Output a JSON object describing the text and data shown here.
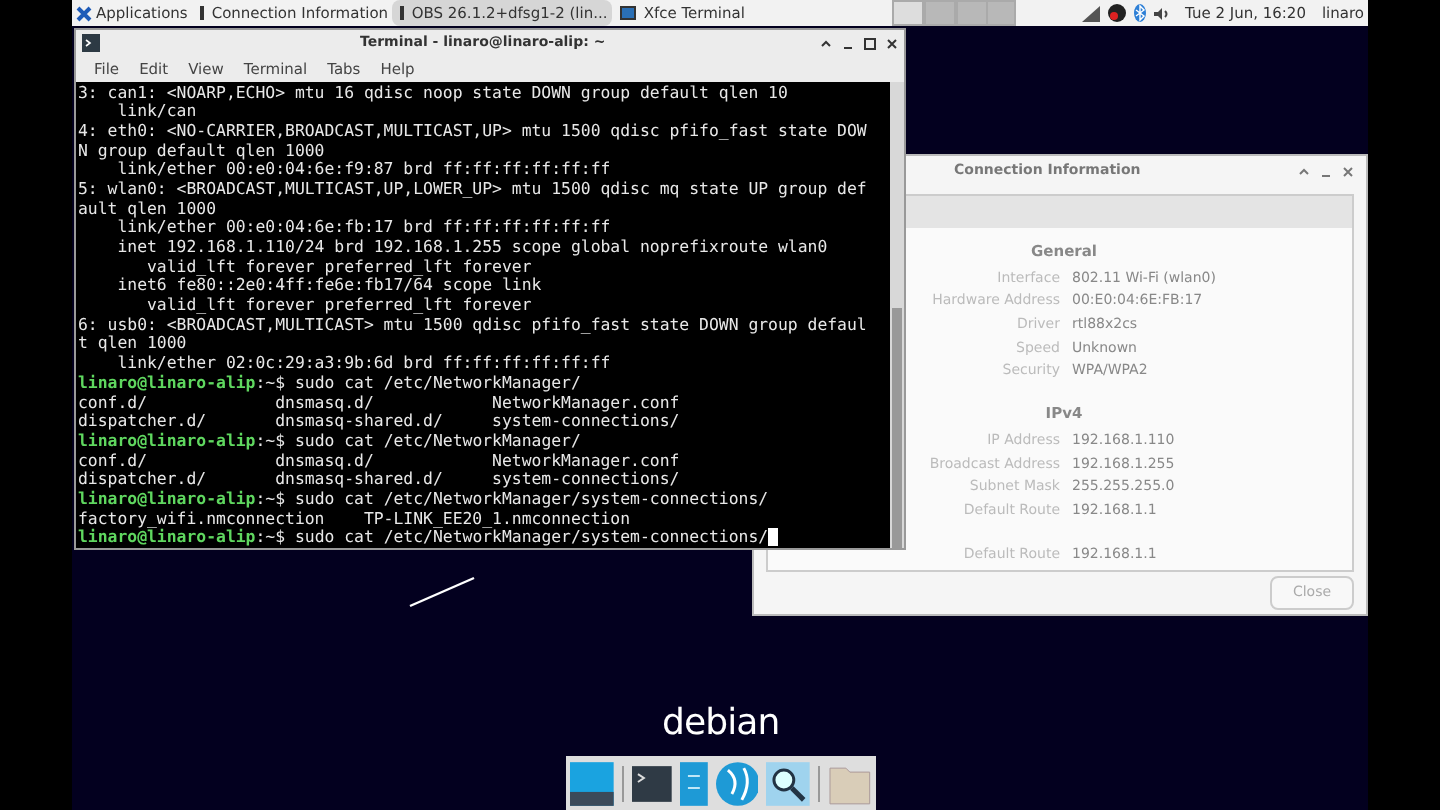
{
  "top_panel": {
    "applications": "Applications",
    "tasks": [
      {
        "label": "Connection Information",
        "selected": false
      },
      {
        "label": "OBS 26.1.2+dfsg1-2 (lin...",
        "selected": true
      },
      {
        "label": "Xfce Terminal",
        "selected": false
      }
    ],
    "clock": "Tue  2 Jun, 16:20",
    "user": "linaro"
  },
  "terminal": {
    "title": "Terminal - linaro@linaro-alip: ~",
    "menu": [
      "File",
      "Edit",
      "View",
      "Terminal",
      "Tabs",
      "Help"
    ],
    "lines": [
      {
        "kind": "output",
        "text": "3: can1: <NOARP,ECHO> mtu 16 qdisc noop state DOWN group default qlen 10"
      },
      {
        "kind": "output",
        "text": "    link/can"
      },
      {
        "kind": "output",
        "text": "4: eth0: <NO-CARRIER,BROADCAST,MULTICAST,UP> mtu 1500 qdisc pfifo_fast state DOW"
      },
      {
        "kind": "output",
        "text": "N group default qlen 1000"
      },
      {
        "kind": "output",
        "text": "    link/ether 00:e0:04:6e:f9:87 brd ff:ff:ff:ff:ff:ff"
      },
      {
        "kind": "output",
        "text": "5: wlan0: <BROADCAST,MULTICAST,UP,LOWER_UP> mtu 1500 qdisc mq state UP group def"
      },
      {
        "kind": "output",
        "text": "ault qlen 1000"
      },
      {
        "kind": "output",
        "text": "    link/ether 00:e0:04:6e:fb:17 brd ff:ff:ff:ff:ff:ff"
      },
      {
        "kind": "output",
        "text": "    inet 192.168.1.110/24 brd 192.168.1.255 scope global noprefixroute wlan0"
      },
      {
        "kind": "output",
        "text": "       valid_lft forever preferred_lft forever"
      },
      {
        "kind": "output",
        "text": "    inet6 fe80::2e0:4ff:fe6e:fb17/64 scope link"
      },
      {
        "kind": "output",
        "text": "       valid_lft forever preferred_lft forever"
      },
      {
        "kind": "output",
        "text": "6: usb0: <BROADCAST,MULTICAST> mtu 1500 qdisc pfifo_fast state DOWN group defaul"
      },
      {
        "kind": "output",
        "text": "t qlen 1000"
      },
      {
        "kind": "output",
        "text": "    link/ether 02:0c:29:a3:9b:6d brd ff:ff:ff:ff:ff:ff"
      },
      {
        "kind": "prompt",
        "prompt": "linaro@linaro-alip",
        "suffix": ":~$",
        "command": " sudo cat /etc/NetworkManager/",
        "cursor": false
      },
      {
        "kind": "output",
        "text": "conf.d/             dnsmasq.d/            NetworkManager.conf"
      },
      {
        "kind": "output",
        "text": "dispatcher.d/       dnsmasq-shared.d/     system-connections/"
      },
      {
        "kind": "prompt",
        "prompt": "linaro@linaro-alip",
        "suffix": ":~$",
        "command": " sudo cat /etc/NetworkManager/",
        "cursor": false
      },
      {
        "kind": "output",
        "text": "conf.d/             dnsmasq.d/            NetworkManager.conf"
      },
      {
        "kind": "output",
        "text": "dispatcher.d/       dnsmasq-shared.d/     system-connections/"
      },
      {
        "kind": "prompt",
        "prompt": "linaro@linaro-alip",
        "suffix": ":~$",
        "command": " sudo cat /etc/NetworkManager/system-connections/",
        "cursor": false
      },
      {
        "kind": "output",
        "text": "factory_wifi.nmconnection    TP-LINK_EE20_1.nmconnection"
      },
      {
        "kind": "prompt",
        "prompt": "linaro@linaro-alip",
        "suffix": ":~$",
        "command": " sudo cat /etc/NetworkManager/system-connections/",
        "cursor": true
      }
    ]
  },
  "connection_window": {
    "title": "Connection Information",
    "sections": [
      {
        "heading": "General",
        "rows": [
          {
            "label": "Interface",
            "value": "802.11 Wi-Fi (wlan0)"
          },
          {
            "label": "Hardware Address",
            "value": "00:E0:04:6E:FB:17"
          },
          {
            "label": "Driver",
            "value": "rtl88x2cs"
          },
          {
            "label": "Speed",
            "value": "Unknown"
          },
          {
            "label": "Security",
            "value": "WPA/WPA2"
          }
        ]
      },
      {
        "heading": "IPv4",
        "rows": [
          {
            "label": "IP Address",
            "value": "192.168.1.110"
          },
          {
            "label": "Broadcast Address",
            "value": "192.168.1.255"
          },
          {
            "label": "Subnet Mask",
            "value": "255.255.255.0"
          },
          {
            "label": "Default Route",
            "value": "192.168.1.1"
          }
        ]
      },
      {
        "rows": [
          {
            "label": "Default Route",
            "value": "192.168.1.1"
          }
        ]
      }
    ],
    "close": "Close"
  },
  "desktop_logo": "debian"
}
